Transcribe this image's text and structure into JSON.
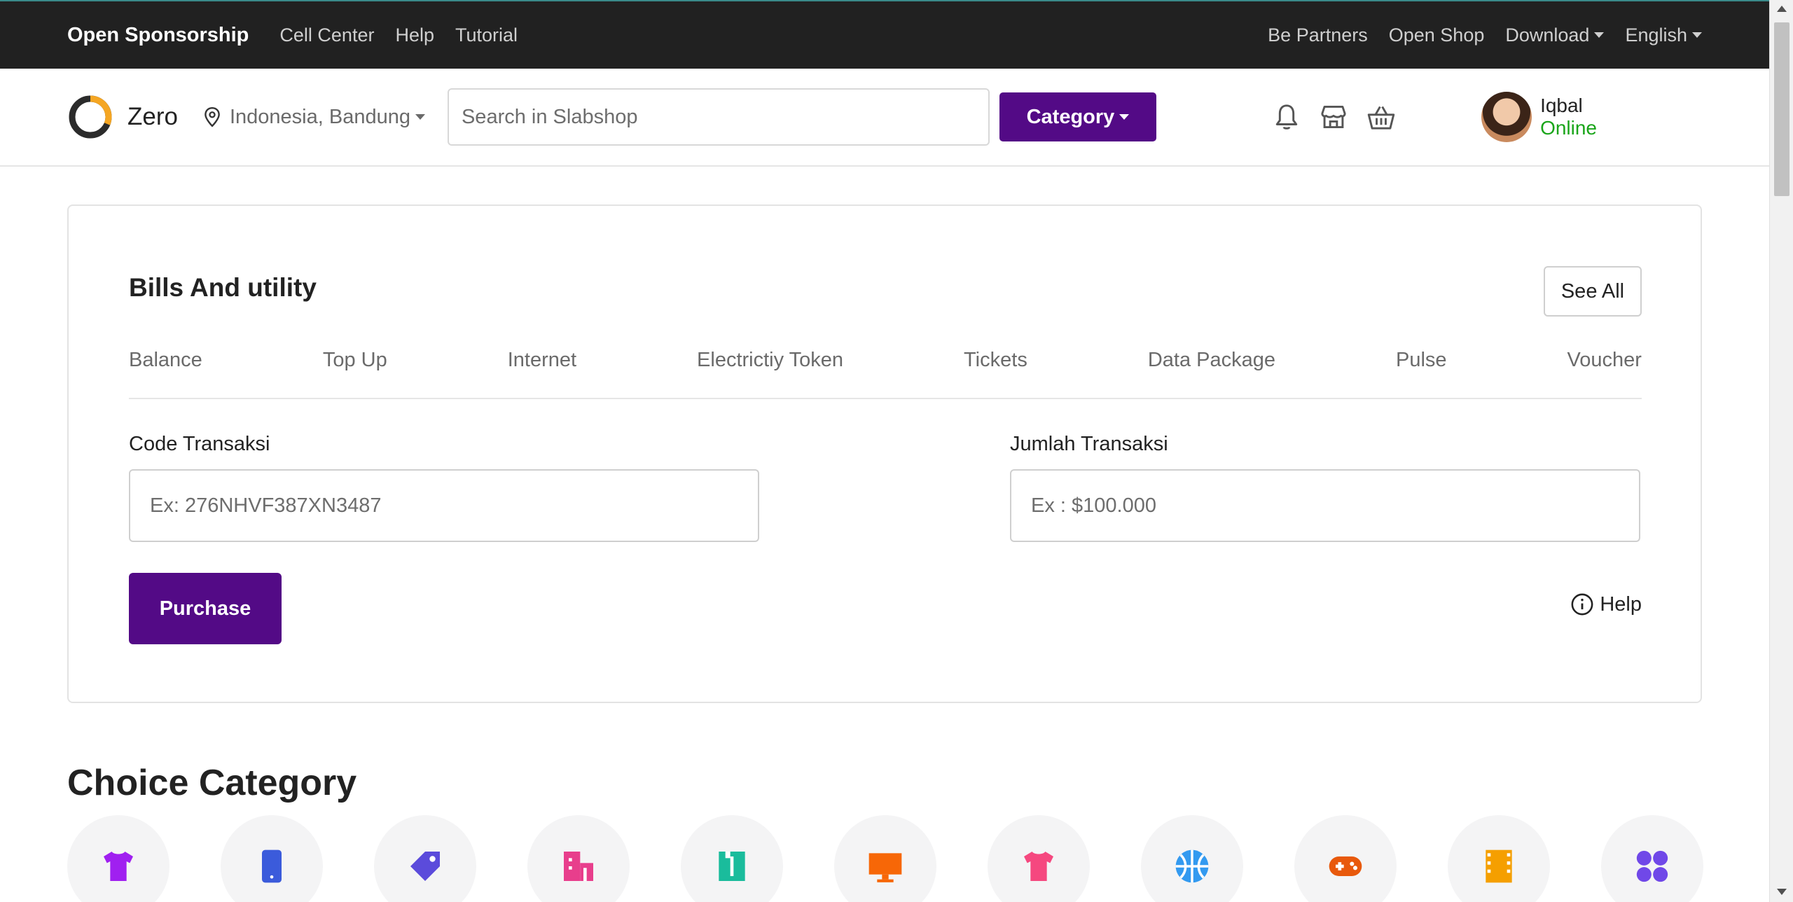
{
  "topnav": {
    "brand": "Open Sponsorship",
    "left_links": [
      "Cell Center",
      "Help",
      "Tutorial"
    ],
    "right_links": [
      "Be Partners",
      "Open Shop"
    ],
    "download": "Download",
    "language": "English"
  },
  "header": {
    "logo_text": "Zero",
    "location": "Indonesia, Bandung",
    "search_placeholder": "Search in Slabshop",
    "category_button": "Category",
    "user_name": "Iqbal",
    "user_status": "Online"
  },
  "bills": {
    "title": "Bills And utility",
    "see_all": "See All",
    "tabs": [
      "Balance",
      "Top Up",
      "Internet",
      "Electrictiy Token",
      "Tickets",
      "Data Package",
      "Pulse",
      "Voucher"
    ],
    "code_label": "Code Transaksi",
    "code_placeholder": "Ex: 276NHVF387XN3487",
    "amount_label": "Jumlah Transaksi",
    "amount_placeholder": "Ex : $100.000",
    "purchase": "Purchase",
    "help": "Help"
  },
  "choice_category": {
    "title": "Choice Category",
    "items": [
      {
        "icon": "tshirt-icon",
        "color": "#a020f0"
      },
      {
        "icon": "smartphone-icon",
        "color": "#3b5bdb"
      },
      {
        "icon": "tag-icon",
        "color": "#5b4bdb"
      },
      {
        "icon": "building-icon",
        "color": "#e83e8c"
      },
      {
        "icon": "shirt-icon",
        "color": "#1abc9c"
      },
      {
        "icon": "monitor-icon",
        "color": "#f76707"
      },
      {
        "icon": "clothing-icon",
        "color": "#f5487f"
      },
      {
        "icon": "basketball-icon",
        "color": "#339af0"
      },
      {
        "icon": "gamepad-icon",
        "color": "#e8590c"
      },
      {
        "icon": "film-icon",
        "color": "#f59f00"
      },
      {
        "icon": "grid-icon",
        "color": "#7048e8"
      }
    ]
  },
  "colors": {
    "primary": "#530a86",
    "online": "#1aa51a",
    "topbar": "#212121"
  }
}
